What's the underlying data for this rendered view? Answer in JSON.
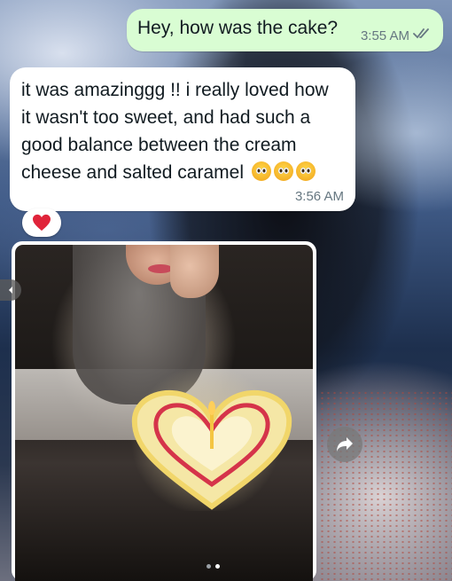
{
  "messages": {
    "outgoing": {
      "text": "Hey, how was the cake?",
      "time": "3:55 AM",
      "status_icon": "double-check-read-icon"
    },
    "incoming": {
      "text_line1": "it was amazinggg !! i really loved how",
      "text_line2": "it wasn't too sweet, and had such a",
      "text_line3": "good balance between the cream",
      "text_line4": "cheese and salted caramel",
      "emoji": [
        "pleading-face-emoji",
        "pleading-face-emoji",
        "pleading-face-emoji"
      ],
      "time": "3:56 AM",
      "reaction": "red-heart"
    },
    "photo": {
      "description_icon": "photo-girl-with-heart-cake",
      "page_count": 2,
      "active_page": 2
    }
  },
  "controls": {
    "forward_icon": "forward-arrow-icon",
    "previous_icon": "chevron-left-icon"
  },
  "colors": {
    "outgoing_bubble": "#d9fdd3",
    "incoming_bubble": "#ffffff",
    "timestamp": "#667781",
    "read_ticks": "#667781",
    "heart": "#e0243a"
  }
}
